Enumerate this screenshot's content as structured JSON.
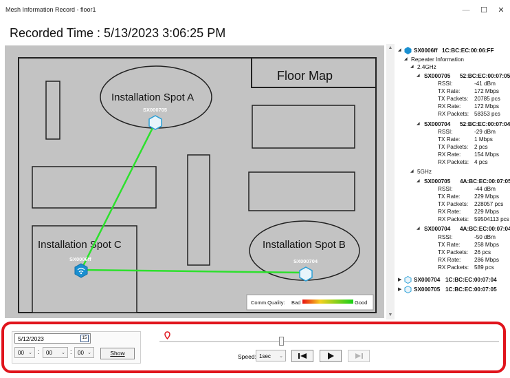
{
  "window": {
    "title": "Mesh Information Record - floor1",
    "minimize": "—",
    "maximize": "☐",
    "close": "✕"
  },
  "recorded_time": "Recorded Time : 5/13/2023 3:06:25 PM",
  "map": {
    "title": "Floor Map",
    "spots": [
      "Installation Spot A",
      "Installation Spot B",
      "Installation Spot C"
    ],
    "nodes": [
      "SX000705",
      "SX000704",
      "SX0006ff"
    ],
    "legend": {
      "label": "Comm.Quality:",
      "bad": "Bad",
      "good": "Good"
    },
    "colors": {
      "link": "#2de02d",
      "background": "#c3c3c3"
    }
  },
  "tree": {
    "root": {
      "name": "SX0006ff",
      "mac": "1C:BC:EC:00:06:FF"
    },
    "repeater_info": "Repeater Information",
    "bands": [
      {
        "label": "2.4GHz",
        "nodes": [
          {
            "name": "SX000705",
            "mac": "52:BC:EC:00:07:05",
            "stats": [
              [
                "RSSI:",
                "-41 dBm"
              ],
              [
                "TX Rate:",
                "172 Mbps"
              ],
              [
                "TX Packets:",
                "20785 pcs"
              ],
              [
                "RX Rate:",
                "172 Mbps"
              ],
              [
                "RX Packets:",
                "58353 pcs"
              ]
            ]
          },
          {
            "name": "SX000704",
            "mac": "52:BC:EC:00:07:04",
            "stats": [
              [
                "RSSI:",
                "-29 dBm"
              ],
              [
                "TX Rate:",
                "1 Mbps"
              ],
              [
                "TX Packets:",
                "2 pcs"
              ],
              [
                "RX Rate:",
                "154 Mbps"
              ],
              [
                "RX Packets:",
                "4 pcs"
              ]
            ]
          }
        ]
      },
      {
        "label": "5GHz",
        "nodes": [
          {
            "name": "SX000705",
            "mac": "4A:BC:EC:00:07:05",
            "stats": [
              [
                "RSSI:",
                "-44 dBm"
              ],
              [
                "TX Rate:",
                "229 Mbps"
              ],
              [
                "TX Packets:",
                "228057 pcs"
              ],
              [
                "RX Rate:",
                "229 Mbps"
              ],
              [
                "RX Packets:",
                "59504113 pcs"
              ]
            ]
          },
          {
            "name": "SX000704",
            "mac": "4A:BC:EC:00:07:04",
            "stats": [
              [
                "RSSI:",
                "-50 dBm"
              ],
              [
                "TX Rate:",
                "258 Mbps"
              ],
              [
                "TX Packets:",
                "26 pcs"
              ],
              [
                "RX Rate:",
                "286 Mbps"
              ],
              [
                "RX Packets:",
                "589 pcs"
              ]
            ]
          }
        ]
      }
    ],
    "others": [
      {
        "name": "SX000704",
        "mac": "1C:BC:EC:00:07:04"
      },
      {
        "name": "SX000705",
        "mac": "1C:BC:EC:00:07:05"
      }
    ]
  },
  "controls": {
    "date": "5/12/2023",
    "calendar": "15",
    "hour": "00",
    "minute": "00",
    "second": "00",
    "show": "Show",
    "speed_label": "Speed:",
    "speed_value": "1sec",
    "playback_fraction": 0.36,
    "highlight_color": "#e0141c"
  }
}
